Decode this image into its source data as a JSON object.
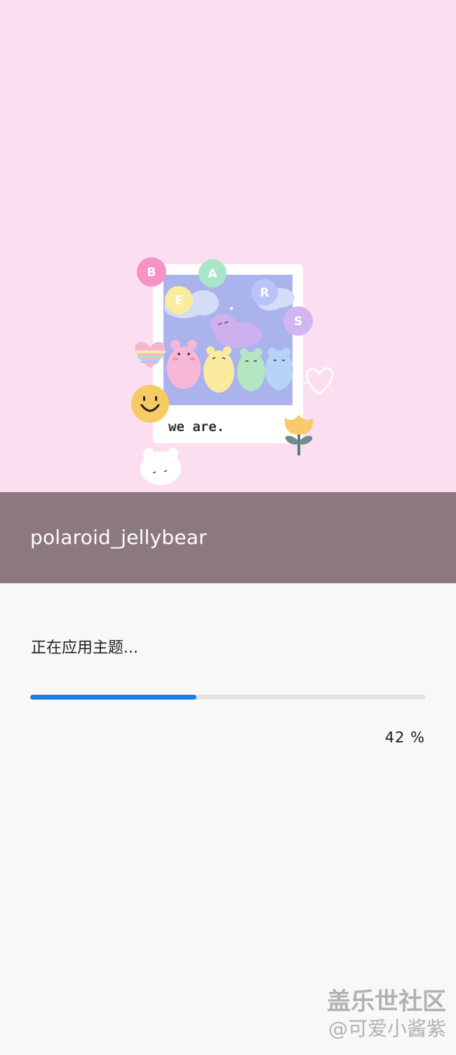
{
  "preview": {
    "illustration_caption": "we are.",
    "balloon_letters": [
      "B",
      "E",
      "A",
      "R",
      "S"
    ]
  },
  "theme": {
    "name": "polaroid_jellybear"
  },
  "apply": {
    "status_text": "正在应用主题...",
    "progress": 0.42,
    "progress_label": "42 %"
  },
  "watermark": {
    "line1": "盖乐世社区",
    "line2": "@可爱小酱紫"
  },
  "colors": {
    "hero_background": "#fbdff0",
    "title_bar": "#8b7880",
    "accent_progress": "#1e7fe0",
    "progress_track": "#e3e3e3",
    "page_background": "#f8f8f8"
  }
}
